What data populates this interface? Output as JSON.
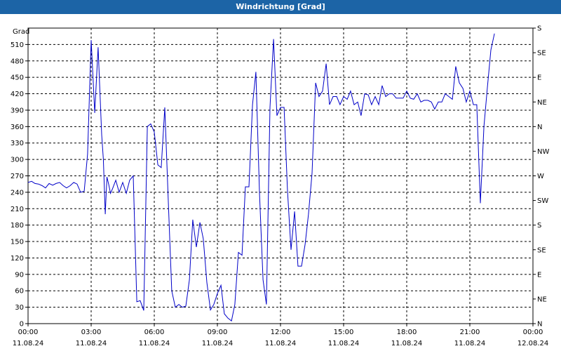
{
  "window": {
    "title": "Windrichtung [Grad]"
  },
  "chart_data": {
    "type": "line",
    "title": "Windrichtung [Grad]",
    "ylabel": "Grad",
    "ylim": [
      0,
      540
    ],
    "y_ticks": [
      0,
      30,
      60,
      90,
      120,
      150,
      180,
      210,
      240,
      270,
      300,
      330,
      360,
      390,
      420,
      450,
      480,
      510
    ],
    "right_ticks": [
      {
        "value": 0,
        "label": "N"
      },
      {
        "value": 45,
        "label": "NE"
      },
      {
        "value": 90,
        "label": "E"
      },
      {
        "value": 135,
        "label": "SE"
      },
      {
        "value": 180,
        "label": "S"
      },
      {
        "value": 225,
        "label": "SW"
      },
      {
        "value": 270,
        "label": "W"
      },
      {
        "value": 315,
        "label": "NW"
      },
      {
        "value": 360,
        "label": "N"
      },
      {
        "value": 405,
        "label": "NE"
      },
      {
        "value": 450,
        "label": "E"
      },
      {
        "value": 495,
        "label": "SE"
      },
      {
        "value": 540,
        "label": "S"
      }
    ],
    "xlim_hours": [
      0,
      24
    ],
    "x_ticks": [
      {
        "hour": 0,
        "time": "00:00",
        "date": "11.08.24"
      },
      {
        "hour": 3,
        "time": "03:00",
        "date": "11.08.24"
      },
      {
        "hour": 6,
        "time": "06:00",
        "date": "11.08.24"
      },
      {
        "hour": 9,
        "time": "09:00",
        "date": "11.08.24"
      },
      {
        "hour": 12,
        "time": "12:00",
        "date": "11.08.24"
      },
      {
        "hour": 15,
        "time": "15:00",
        "date": "11.08.24"
      },
      {
        "hour": 18,
        "time": "18:00",
        "date": "11.08.24"
      },
      {
        "hour": 21,
        "time": "21:00",
        "date": "11.08.24"
      },
      {
        "hour": 24,
        "time": "00:00",
        "date": "12.08.24"
      }
    ],
    "grid": true,
    "line_color": "#0000c8",
    "series": [
      {
        "x_hours": [
          0,
          0.17,
          0.33,
          0.5,
          0.67,
          0.83,
          1,
          1.17,
          1.33,
          1.5,
          1.67,
          1.83,
          2,
          2.17,
          2.33,
          2.5,
          2.67,
          2.83,
          3,
          3.17,
          3.33,
          3.5,
          3.58,
          3.67,
          3.75,
          3.83,
          3.92,
          4,
          4.17,
          4.33,
          4.5,
          4.67,
          4.83,
          5,
          5.17,
          5.33,
          5.5,
          5.67,
          5.83,
          6,
          6.17,
          6.33,
          6.5,
          6.67,
          6.83,
          7,
          7.17,
          7.33,
          7.5,
          7.67,
          7.83,
          8,
          8.17,
          8.33,
          8.5,
          8.67,
          8.83,
          9,
          9.17,
          9.33,
          9.5,
          9.67,
          9.83,
          10,
          10.17,
          10.33,
          10.5,
          10.67,
          10.83,
          11,
          11.17,
          11.33,
          11.5,
          11.67,
          11.83,
          12,
          12.17,
          12.33,
          12.5,
          12.67,
          12.83,
          13,
          13.17,
          13.33,
          13.5,
          13.67,
          13.83,
          14,
          14.17,
          14.33,
          14.5,
          14.67,
          14.83,
          15,
          15.17,
          15.33,
          15.5,
          15.67,
          15.83,
          16,
          16.17,
          16.33,
          16.5,
          16.67,
          16.83,
          17,
          17.17,
          17.33,
          17.5,
          17.67,
          17.83,
          18,
          18.17,
          18.33,
          18.5,
          18.67,
          18.83,
          19,
          19.17,
          19.33,
          19.5,
          19.67,
          19.83,
          20,
          20.17,
          20.33,
          20.5,
          20.67,
          20.83,
          21,
          21.17,
          21.33,
          21.5,
          21.67,
          21.83,
          22,
          22.17,
          22.33,
          22.5,
          22.67,
          22.83,
          23,
          23.17,
          23.33,
          23.5,
          23.67,
          23.83
        ],
        "values": [
          258,
          260,
          256,
          255,
          252,
          248,
          256,
          253,
          256,
          258,
          252,
          248,
          252,
          258,
          255,
          240,
          242,
          310,
          518,
          385,
          505,
          345,
          300,
          200,
          268,
          255,
          238,
          245,
          262,
          240,
          258,
          238,
          262,
          270,
          40,
          42,
          24,
          360,
          365,
          350,
          290,
          285,
          395,
          220,
          60,
          30,
          35,
          30,
          32,
          80,
          190,
          140,
          185,
          155,
          75,
          25,
          35,
          55,
          70,
          18,
          10,
          5,
          35,
          130,
          125,
          250,
          250,
          400,
          460,
          240,
          80,
          35,
          395,
          520,
          380,
          395,
          395,
          245,
          135,
          205,
          105,
          105,
          145,
          200,
          275,
          440,
          415,
          425,
          475,
          400,
          415,
          415,
          400,
          415,
          410,
          425,
          400,
          405,
          380,
          420,
          418,
          400,
          415,
          400,
          435,
          415,
          420,
          420,
          412,
          412,
          412,
          425,
          412,
          410,
          420,
          405,
          408,
          408,
          405,
          392,
          405,
          405,
          420,
          415,
          410,
          470,
          440,
          430,
          405,
          425,
          400,
          400,
          220,
          360,
          430,
          500,
          530
        ]
      }
    ]
  }
}
